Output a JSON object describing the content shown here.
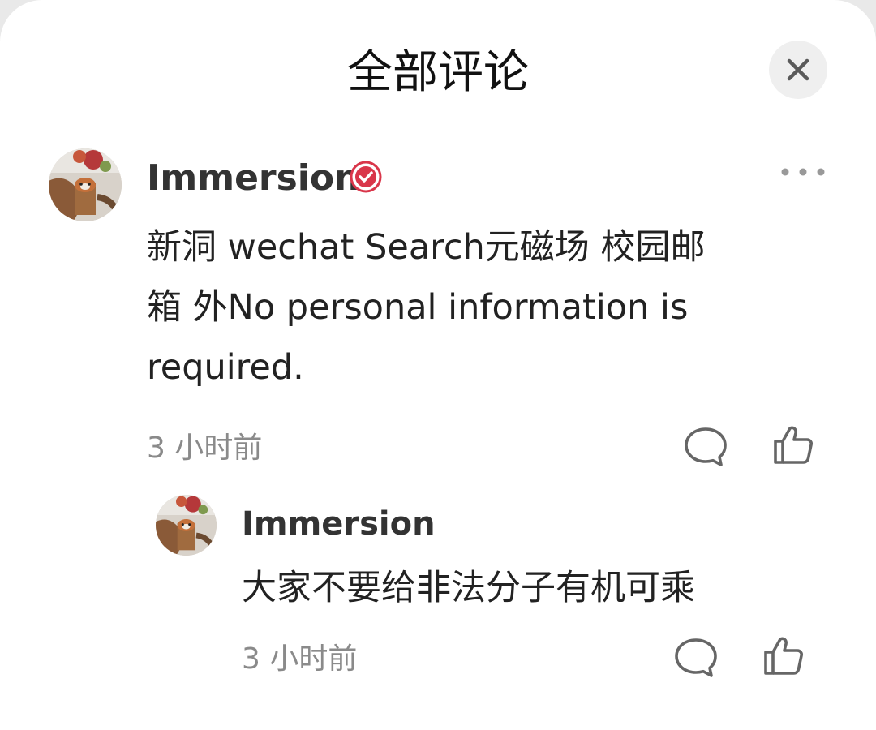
{
  "sheet": {
    "title": "全部评论",
    "close_icon": "close-icon"
  },
  "comments": [
    {
      "author": "Immersion",
      "verified": true,
      "content_line1": "新洞 wechat Search元磁场 校园邮",
      "content_line2": "箱 外No personal information is",
      "content_line3": "required.",
      "time": "3 小时前",
      "icons": [
        "more-icon",
        "comment-bubble-icon",
        "like-thumb-icon"
      ],
      "replies": [
        {
          "author": "Immersion",
          "content": "大家不要给非法分子有机可乘",
          "time": "3 小时前",
          "icons": [
            "comment-bubble-icon",
            "like-thumb-icon"
          ]
        }
      ]
    }
  ],
  "colors": {
    "accent_verified": "#d9364a",
    "text_primary": "#222222",
    "text_secondary": "#8a8a8a"
  }
}
